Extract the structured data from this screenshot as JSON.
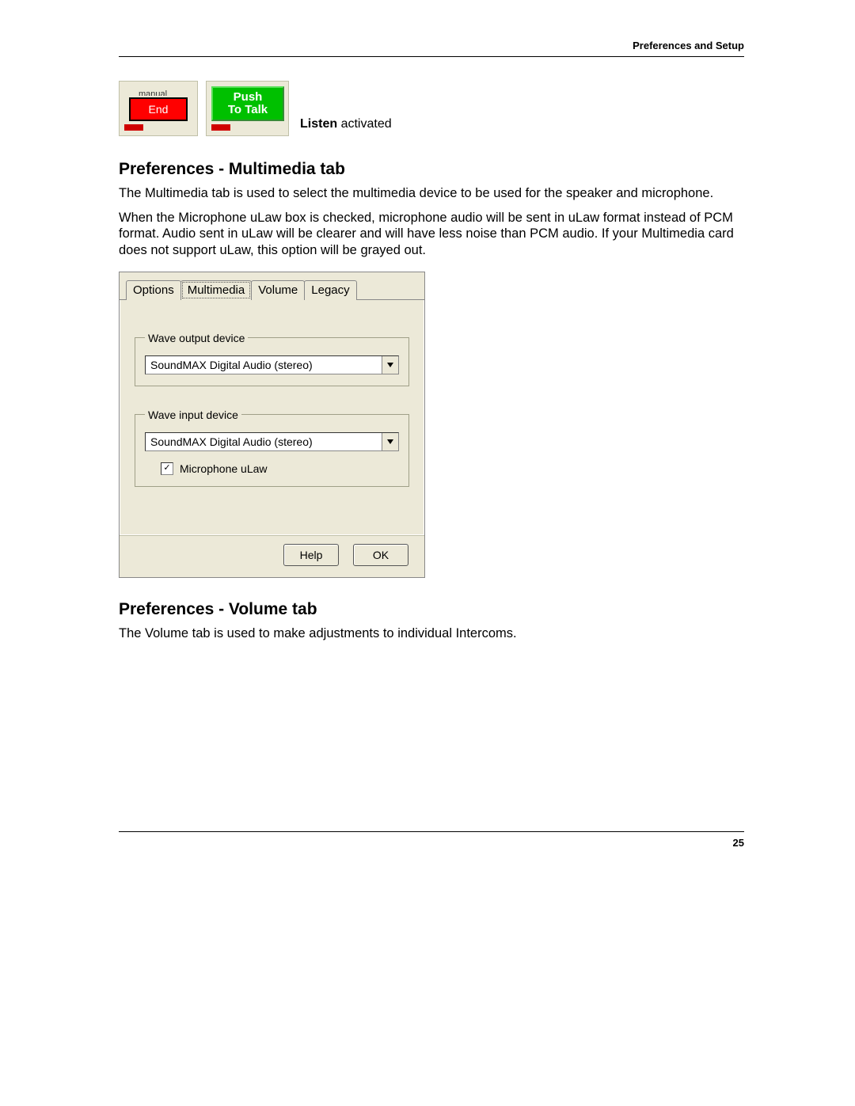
{
  "header": {
    "title": "Preferences and Setup"
  },
  "top_panels": {
    "left": {
      "cutoff_label": "manual",
      "button": "End"
    },
    "right": {
      "button_line1": "Push",
      "button_line2": "To Talk"
    },
    "caption_bold": "Listen",
    "caption_rest": " activated"
  },
  "section1": {
    "heading": "Preferences - Multimedia tab",
    "para1": "The Multimedia tab is used to select the multimedia device to be used for the speaker and microphone.",
    "para2": "When the Microphone uLaw box is checked, microphone audio will be sent in uLaw format instead of PCM format.  Audio sent in uLaw will be clearer and will have less noise than PCM audio.  If your Multimedia card does not support uLaw, this option will be grayed out."
  },
  "dialog": {
    "tabs": [
      "Options",
      "Multimedia",
      "Volume",
      "Legacy"
    ],
    "active_tab_index": 1,
    "group_output": {
      "legend": "Wave output device",
      "value": "SoundMAX Digital Audio (stereo)"
    },
    "group_input": {
      "legend": "Wave input device",
      "value": "SoundMAX Digital Audio (stereo)",
      "checkbox_label": "Microphone uLaw",
      "checkbox_checked": true
    },
    "buttons": {
      "help": "Help",
      "ok": "OK"
    }
  },
  "section2": {
    "heading": "Preferences - Volume tab",
    "para1": "The Volume tab is used to make adjustments to individual Intercoms."
  },
  "footer": {
    "page_number": "25"
  }
}
